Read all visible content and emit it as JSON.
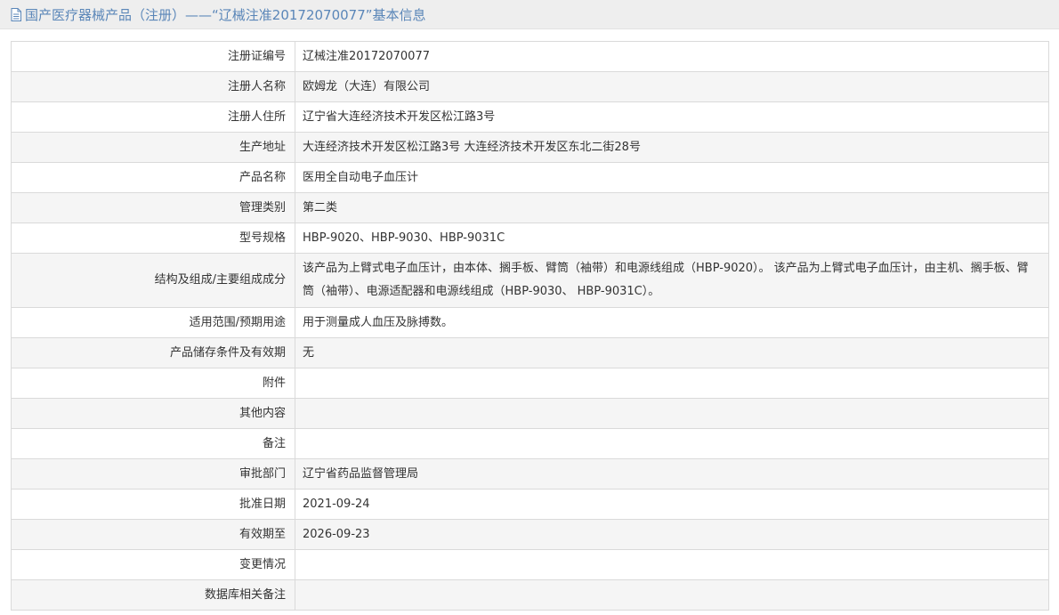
{
  "page": {
    "title": "国产医疗器械产品（注册）——“辽械注准20172070077”基本信息",
    "title_icon": "document-icon",
    "title_color": "#5a86b8"
  },
  "rows": [
    {
      "label": "注册证编号",
      "value": "辽械注准20172070077"
    },
    {
      "label": "注册人名称",
      "value": "欧姆龙（大连）有限公司"
    },
    {
      "label": "注册人住所",
      "value": "辽宁省大连经济技术开发区松江路3号"
    },
    {
      "label": "生产地址",
      "value": "大连经济技术开发区松江路3号 大连经济技术开发区东北二街28号"
    },
    {
      "label": "产品名称",
      "value": "医用全自动电子血压计"
    },
    {
      "label": "管理类别",
      "value": "第二类"
    },
    {
      "label": "型号规格",
      "value": "HBP-9020、HBP-9030、HBP-9031C"
    },
    {
      "label": "结构及组成/主要组成成分",
      "value": "该产品为上臂式电子血压计，由本体、搁手板、臂筒（袖带）和电源线组成（HBP-9020）。 该产品为上臂式电子血压计，由主机、搁手板、臂筒（袖带）、电源适配器和电源线组成（HBP-9030、 HBP-9031C）。"
    },
    {
      "label": "适用范围/预期用途",
      "value": "用于测量成人血压及脉搏数。"
    },
    {
      "label": "产品储存条件及有效期",
      "value": "无"
    },
    {
      "label": "附件",
      "value": ""
    },
    {
      "label": "其他内容",
      "value": ""
    },
    {
      "label": "备注",
      "value": ""
    },
    {
      "label": "审批部门",
      "value": "辽宁省药品监督管理局"
    },
    {
      "label": "批准日期",
      "value": "2021-09-24"
    },
    {
      "label": "有效期至",
      "value": "2026-09-23"
    },
    {
      "label": "变更情况",
      "value": ""
    },
    {
      "label": "数据库相关备注",
      "value": ""
    }
  ]
}
